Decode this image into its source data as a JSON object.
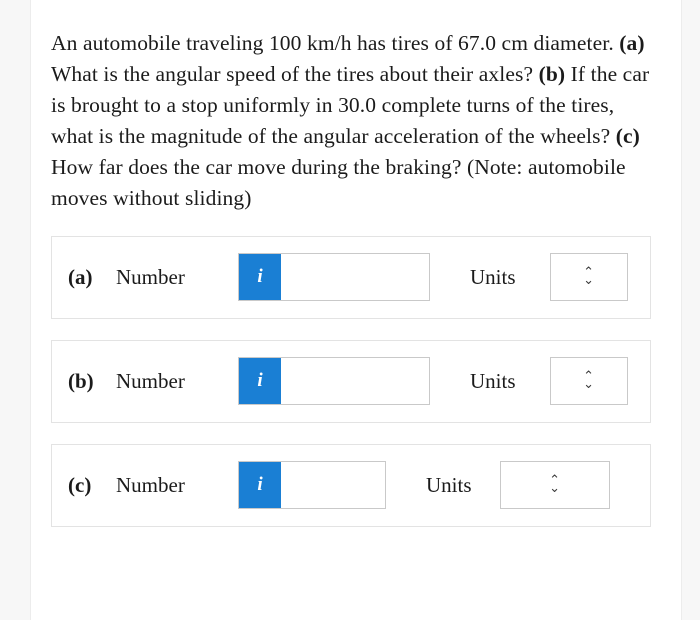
{
  "question": {
    "segments": [
      {
        "text": "An automobile traveling 100 km/h has tires of 67.0 cm diameter. ",
        "bold": false
      },
      {
        "text": "(a)",
        "bold": true
      },
      {
        "text": " What is the angular speed of the tires about their axles? ",
        "bold": false
      },
      {
        "text": "(b)",
        "bold": true
      },
      {
        "text": " If the car is brought to a stop uniformly in 30.0 complete turns of the tires, what is the magnitude of the angular acceleration of the wheels? ",
        "bold": false
      },
      {
        "text": "(c)",
        "bold": true
      },
      {
        "text": " How far does the car move during the braking? (Note: automobile moves without sliding)",
        "bold": false
      }
    ],
    "full_text": "An automobile traveling 100 km/h has tires of 67.0 cm diameter. (a) What is the angular speed of the tires about their axles? (b) If the car is brought to a stop uniformly in 30.0 complete turns of the tires, what is the magnitude of the angular acceleration of the wheels? (c) How far does the car move during the braking? (Note: automobile moves without sliding)"
  },
  "answer_rows": [
    {
      "part": "(a)",
      "number_label": "Number",
      "info_glyph": "i",
      "number_value": "",
      "number_placeholder": "",
      "units_label": "Units",
      "units_selected": "",
      "units_chevron": "⌃⌄"
    },
    {
      "part": "(b)",
      "number_label": "Number",
      "info_glyph": "i",
      "number_value": "",
      "number_placeholder": "",
      "units_label": "Units",
      "units_selected": "",
      "units_chevron": "⌃⌄"
    },
    {
      "part": "(c)",
      "number_label": "Number",
      "info_glyph": "i",
      "number_value": "",
      "number_placeholder": "",
      "units_label": "Units",
      "units_selected": "",
      "units_chevron": "⌃⌄"
    }
  ],
  "colors": {
    "info_button": "#1a7fd4",
    "rail": "#f7f7f7",
    "border": "#e3e3e3",
    "text": "#1b1b1b"
  }
}
